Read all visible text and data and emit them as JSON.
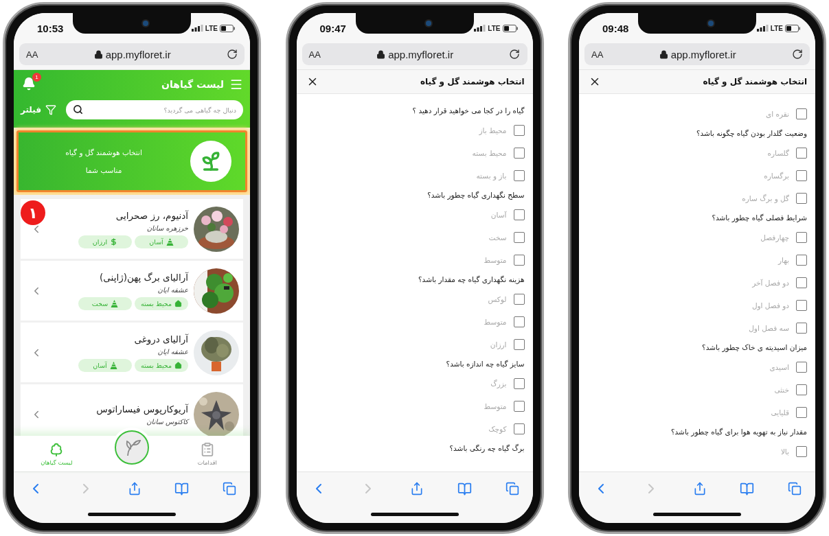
{
  "phones": [
    {
      "kind": "quiz",
      "status": {
        "time": "09:48",
        "network": "LTE"
      },
      "browser": {
        "text_size": "AA",
        "url": "app.myfloret.ir"
      },
      "title": "انتخاب هوشمند گل و گیاه",
      "items": [
        {
          "kind": "option",
          "label": "نقره ای",
          "checked": false
        },
        {
          "kind": "question",
          "text": "وضعیت گلدار بودن گیاه چگونه باشد؟"
        },
        {
          "kind": "option",
          "label": "گلساره",
          "checked": false
        },
        {
          "kind": "option",
          "label": "برگساره",
          "checked": false
        },
        {
          "kind": "option",
          "label": "گل و برگ ساره",
          "checked": false
        },
        {
          "kind": "question",
          "text": "شرایط فصلی گیاه چطور باشد؟"
        },
        {
          "kind": "option",
          "label": "چهارفصل",
          "checked": false
        },
        {
          "kind": "option",
          "label": "بهار",
          "checked": false
        },
        {
          "kind": "option",
          "label": "دو فصل آخر",
          "checked": false
        },
        {
          "kind": "option",
          "label": "دو فصل اول",
          "checked": false
        },
        {
          "kind": "option",
          "label": "سه فصل اول",
          "checked": false
        },
        {
          "kind": "question",
          "text": "میزان اسیدیته ی خاک چطور باشد؟"
        },
        {
          "kind": "option",
          "label": "اسیدی",
          "checked": false
        },
        {
          "kind": "option",
          "label": "خنثی",
          "checked": false
        },
        {
          "kind": "option",
          "label": "قلیایی",
          "checked": false
        },
        {
          "kind": "question",
          "text": "مقدار نیاز به تهویه هوا برای گیاه چطور باشد؟"
        },
        {
          "kind": "option",
          "label": "بالا",
          "checked": false
        }
      ]
    },
    {
      "kind": "quiz",
      "status": {
        "time": "09:47",
        "network": "LTE"
      },
      "browser": {
        "text_size": "AA",
        "url": "app.myfloret.ir"
      },
      "title": "انتخاب هوشمند گل و گیاه",
      "items": [
        {
          "kind": "question",
          "text": "گیاه را در کجا می خواهید قرار دهید ؟"
        },
        {
          "kind": "option",
          "label": "محیط باز",
          "checked": false
        },
        {
          "kind": "option",
          "label": "محیط بسته",
          "checked": false
        },
        {
          "kind": "option",
          "label": "باز و بسته",
          "checked": false
        },
        {
          "kind": "question",
          "text": "سطح نگهداری گیاه چطور باشد؟"
        },
        {
          "kind": "option",
          "label": "آسان",
          "checked": false
        },
        {
          "kind": "option",
          "label": "سخت",
          "checked": false
        },
        {
          "kind": "option",
          "label": "متوسط",
          "checked": false
        },
        {
          "kind": "question",
          "text": "هزینه نگهداری گیاه چه مقدار باشد؟"
        },
        {
          "kind": "option",
          "label": "لوکس",
          "checked": false
        },
        {
          "kind": "option",
          "label": "متوسط",
          "checked": false
        },
        {
          "kind": "option",
          "label": "ارزان",
          "checked": false
        },
        {
          "kind": "question",
          "text": "سایز گیاه چه اندازه باشد؟"
        },
        {
          "kind": "option",
          "label": "بزرگ",
          "checked": false
        },
        {
          "kind": "option",
          "label": "متوسط",
          "checked": false
        },
        {
          "kind": "option",
          "label": "کوچک",
          "checked": false
        },
        {
          "kind": "question",
          "text": "برگ گیاه چه رنگی باشد؟"
        }
      ]
    },
    {
      "kind": "plant_list",
      "status": {
        "time": "10:53",
        "network": "LTE"
      },
      "browser": {
        "text_size": "AA",
        "url": "app.myfloret.ir"
      },
      "header": {
        "title": "لیست گیاهان",
        "notification_count": "1"
      },
      "search": {
        "placeholder": "دنبال چه گیاهی می گردید؟"
      },
      "filter_label": "فیلتر",
      "banner": {
        "title": "انتخاب هوشمند گل و گیاه",
        "subtitle": "مناسب شما",
        "highlighted": true
      },
      "step_badge": "۱",
      "plants": [
        {
          "name": "آدنیوم، رز صحرایی",
          "family": "خرزهره سانان",
          "tags": [
            {
              "kind": "difficulty",
              "label": "آسان"
            },
            {
              "kind": "price",
              "label": "ارزان"
            }
          ]
        },
        {
          "name": "آرالیای برگ پهن(ژاپنی)",
          "family": "عشقه ایان",
          "tags": [
            {
              "kind": "environment",
              "label": "محیط بسته"
            },
            {
              "kind": "difficulty",
              "label": "سخت"
            }
          ]
        },
        {
          "name": "آرالیای دروغی",
          "family": "عشقه ایان",
          "tags": [
            {
              "kind": "environment",
              "label": "محیط بسته"
            },
            {
              "kind": "difficulty",
              "label": "آسان"
            }
          ]
        },
        {
          "name": "آریوکارپوس فیساراتوس",
          "family": "کاکتوس سانان"
        }
      ],
      "bottom_nav": [
        {
          "kind": "actions",
          "label": "اقدامات",
          "selected": false
        },
        {
          "kind": "center"
        },
        {
          "kind": "plants",
          "label": "لیست گیاهان",
          "selected": true
        }
      ]
    }
  ]
}
